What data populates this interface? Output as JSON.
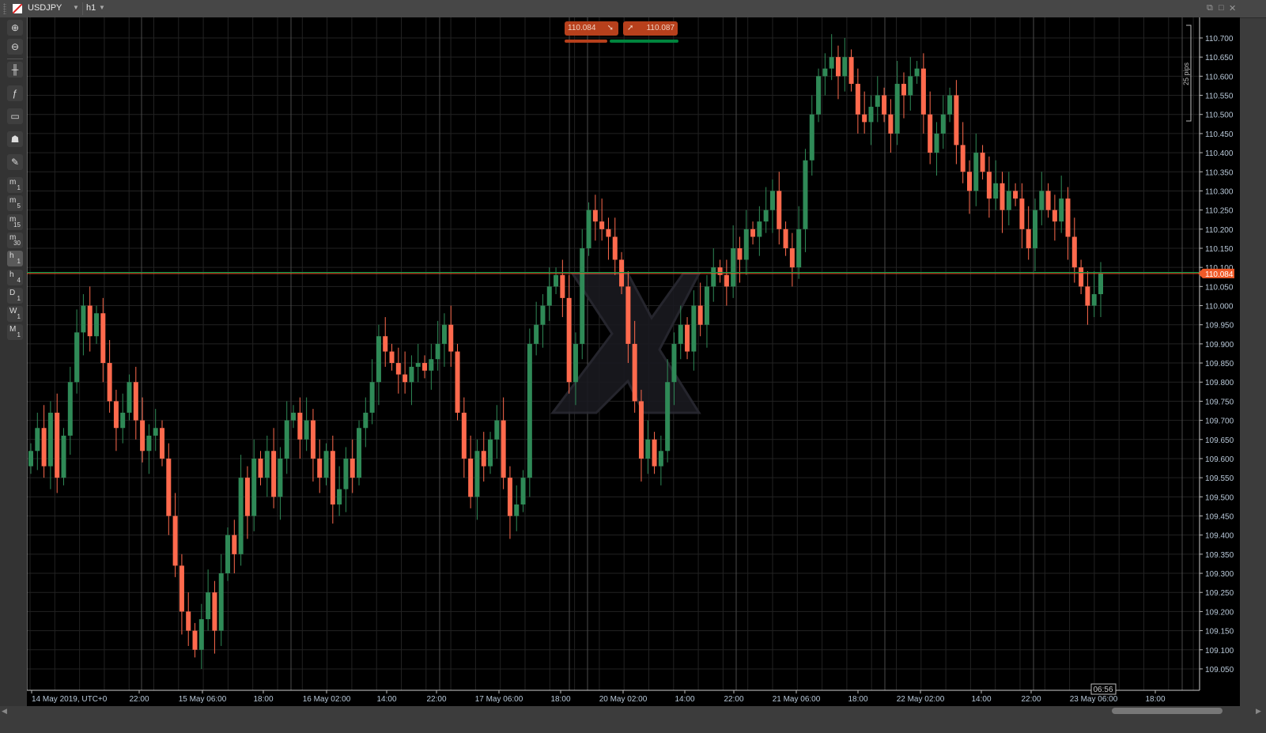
{
  "header": {
    "symbol": "USDJPY",
    "timeframe": "h1"
  },
  "toolbar": {
    "zoom_in": "zoom-in",
    "zoom_out": "zoom-out",
    "timeframes": [
      {
        "a": "m",
        "b": "1"
      },
      {
        "a": "m",
        "b": "5"
      },
      {
        "a": "m",
        "b": "15"
      },
      {
        "a": "m",
        "b": "30"
      },
      {
        "a": "h",
        "b": "1",
        "selected": true
      },
      {
        "a": "h",
        "b": "4"
      },
      {
        "a": "D",
        "b": "1"
      },
      {
        "a": "W",
        "b": "1"
      },
      {
        "a": "M",
        "b": "1"
      }
    ]
  },
  "quotes": {
    "sell": "110.084",
    "buy": "110.087",
    "current_price_label": "110.084"
  },
  "measure": {
    "label": "25 pips"
  },
  "cursor_time": "06:56",
  "colors": {
    "up": "#2f8a57",
    "down": "#ff6a4d",
    "bid_line": "#f05a28",
    "ask_line": "#00a050"
  },
  "chart_data": {
    "type": "candlestick",
    "title": "USDJPY h1",
    "ylim": [
      109.02,
      110.74
    ],
    "y_ticks": [
      "110.700",
      "110.650",
      "110.600",
      "110.550",
      "110.500",
      "110.450",
      "110.400",
      "110.350",
      "110.300",
      "110.250",
      "110.200",
      "110.150",
      "110.100",
      "110.050",
      "110.000",
      "109.950",
      "109.900",
      "109.850",
      "109.800",
      "109.750",
      "109.700",
      "109.650",
      "109.600",
      "109.550",
      "109.500",
      "109.450",
      "109.400",
      "109.350",
      "109.300",
      "109.250",
      "109.200",
      "109.150",
      "109.100",
      "109.050"
    ],
    "x_ticks": [
      "14 May 2019, UTC+0",
      "22:00",
      "15 May 06:00",
      "18:00",
      "16 May 02:00",
      "14:00",
      "22:00",
      "17 May 06:00",
      "18:00",
      "20 May 02:00",
      "14:00",
      "22:00",
      "21 May 06:00",
      "18:00",
      "22 May 02:00",
      "14:00",
      "22:00",
      "23 May 06:00",
      "18:00"
    ],
    "open_first": 109.58,
    "close": [
      109.62,
      109.68,
      109.58,
      109.72,
      109.55,
      109.66,
      109.8,
      109.93,
      110.0,
      109.92,
      109.98,
      109.85,
      109.75,
      109.68,
      109.72,
      109.8,
      109.7,
      109.62,
      109.66,
      109.68,
      109.6,
      109.45,
      109.32,
      109.2,
      109.15,
      109.1,
      109.18,
      109.25,
      109.15,
      109.3,
      109.4,
      109.35,
      109.55,
      109.45,
      109.6,
      109.55,
      109.62,
      109.5,
      109.6,
      109.7,
      109.72,
      109.65,
      109.7,
      109.6,
      109.55,
      109.62,
      109.48,
      109.52,
      109.6,
      109.55,
      109.68,
      109.72,
      109.8,
      109.92,
      109.88,
      109.85,
      109.82,
      109.8,
      109.84,
      109.85,
      109.83,
      109.86,
      109.9,
      109.95,
      109.88,
      109.72,
      109.6,
      109.5,
      109.62,
      109.58,
      109.65,
      109.7,
      109.55,
      109.45,
      109.48,
      109.55,
      109.9,
      109.95,
      110.0,
      110.05,
      110.08,
      110.02,
      109.8,
      109.9,
      110.15,
      110.25,
      110.22,
      110.2,
      110.18,
      110.12,
      110.05,
      109.9,
      109.75,
      109.6,
      109.65,
      109.58,
      109.62,
      109.8,
      109.9,
      109.95,
      109.88,
      110.0,
      109.95,
      110.05,
      110.1,
      110.08,
      110.05,
      110.15,
      110.12,
      110.2,
      110.18,
      110.22,
      110.25,
      110.3,
      110.2,
      110.15,
      110.1,
      110.2,
      110.38,
      110.5,
      110.6,
      110.62,
      110.65,
      110.6,
      110.65,
      110.58,
      110.5,
      110.48,
      110.52,
      110.55,
      110.5,
      110.45,
      110.58,
      110.55,
      110.6,
      110.62,
      110.5,
      110.4,
      110.45,
      110.5,
      110.55,
      110.42,
      110.35,
      110.3,
      110.4,
      110.35,
      110.28,
      110.32,
      110.25,
      110.3,
      110.28,
      110.2,
      110.15,
      110.25,
      110.3,
      110.25,
      110.22,
      110.28,
      110.18,
      110.1,
      110.05,
      110.0,
      110.03,
      110.084
    ],
    "current_bid": 110.084,
    "current_ask": 110.087
  }
}
